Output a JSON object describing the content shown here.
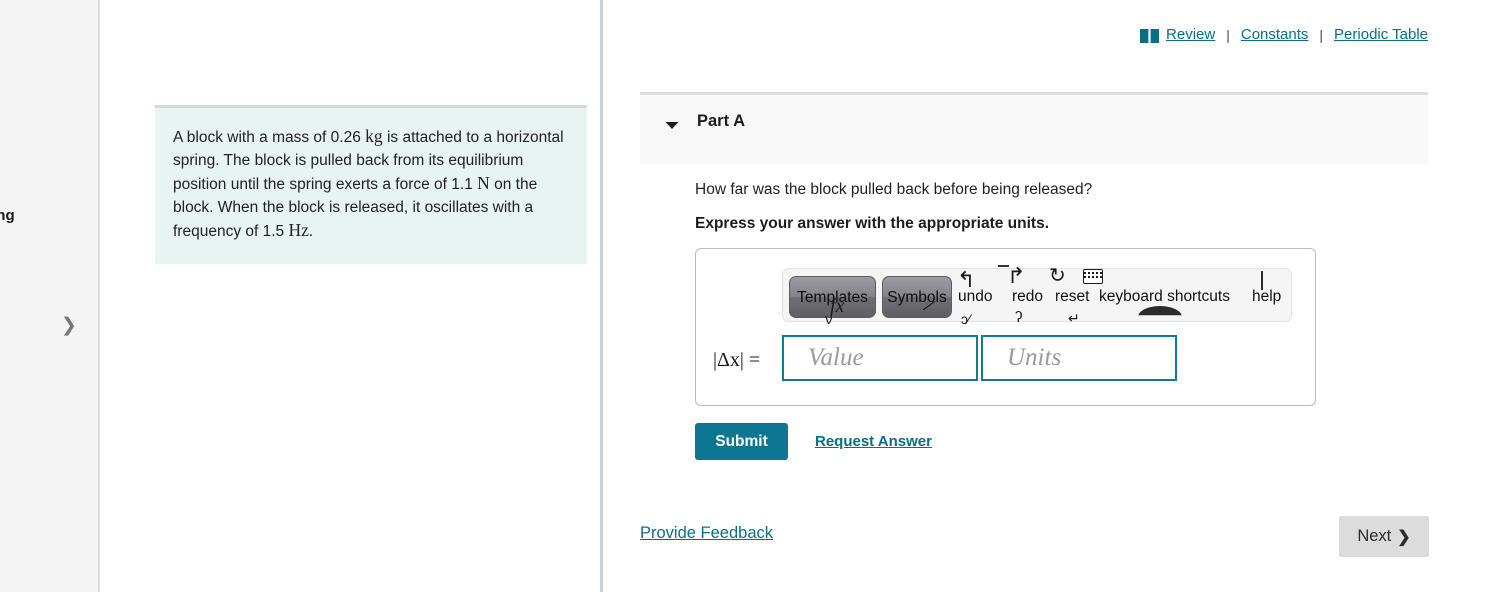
{
  "left_rail": {
    "truncated_label": "ring",
    "expand_icon": "chevron-right-icon"
  },
  "problem": {
    "text_parts": [
      {
        "t": "A block with a mass of ",
        "unit": false
      },
      {
        "t": "0.26 ",
        "unit": false
      },
      {
        "t": "kg",
        "unit": true
      },
      {
        "t": " is attached to a horizontal spring. The block is pulled back from its equilibrium position until the spring exerts a force of 1.1 ",
        "unit": false
      },
      {
        "t": "N",
        "unit": true
      },
      {
        "t": " on the block. When the block is released, it oscillates with a frequency of 1.5 ",
        "unit": false
      },
      {
        "t": "Hz",
        "unit": true
      },
      {
        "t": ".",
        "unit": false
      }
    ],
    "mass": "0.26 kg",
    "force": "1.1 N",
    "frequency": "1.5 Hz"
  },
  "resources": {
    "book_icon": "open-book-icon",
    "review": "Review",
    "separator": "|",
    "constants": "Constants",
    "periodic_table": "Periodic Table"
  },
  "part": {
    "toggle_icon": "caret-down-icon",
    "title": "Part A",
    "question": "How far was the block pulled back before being released?",
    "instruction": "Express your answer with the appropriate units."
  },
  "toolbar": {
    "templates": "Templates",
    "symbols": "Symbols",
    "undo": "undo",
    "redo": "redo",
    "reset": "reset",
    "keyboard_shortcuts": "keyboard shortcuts",
    "help": "help",
    "undo_icon": "undo-arrow-icon",
    "redo_icon": "redo-arrow-icon",
    "reset_icon": "reset-arrow-icon",
    "keyboard_icon": "keyboard-icon",
    "artifacts": {
      "fx": "fx",
      "low_tmpl": "ν",
      "slash": "⁄",
      "low_redo": "ʔ",
      "low_undo": "ɔ∕",
      "low_reset": "↵"
    }
  },
  "answer": {
    "label": "|Δx| =",
    "value_placeholder": "Value",
    "units_placeholder": "Units",
    "value": "",
    "units": "",
    "submit": "Submit",
    "request_answer": "Request Answer"
  },
  "footer": {
    "provide_feedback": "Provide Feedback",
    "next": "Next",
    "next_chevron": "❯"
  },
  "colors": {
    "link_teal": "#0b6e87",
    "submit_teal": "#0d7792",
    "field_border": "#0f7b96",
    "problem_bg": "#e7f4f2",
    "panel_bg": "#f8f8f8",
    "next_bg": "#dcdcdc"
  }
}
